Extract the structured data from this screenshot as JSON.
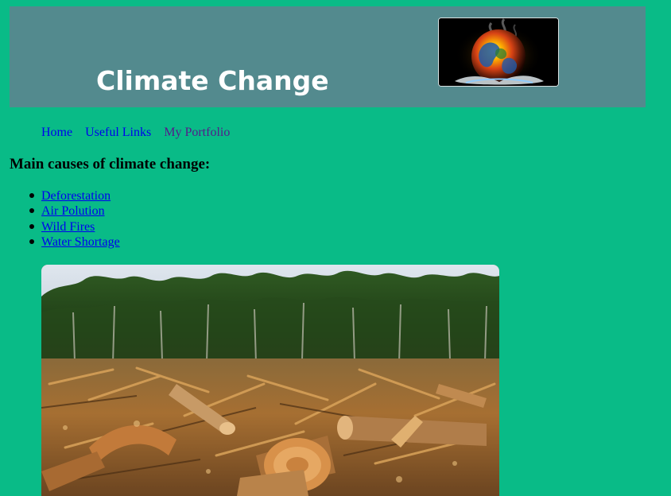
{
  "header": {
    "title": "Climate Change"
  },
  "nav": {
    "items": [
      {
        "label": "Home",
        "name": "nav-link-home",
        "visited": false
      },
      {
        "label": "Useful Links",
        "name": "nav-link-useful-links",
        "visited": false
      },
      {
        "label": "My Portfolio",
        "name": "nav-link-my-portfolio",
        "visited": true
      }
    ]
  },
  "main": {
    "heading": "Main causes of climate change:",
    "causes": [
      {
        "label": "Deforestation",
        "name": "cause-link-deforestation"
      },
      {
        "label": "Air Polution",
        "name": "cause-link-air-polution"
      },
      {
        "label": "Wild Fires",
        "name": "cause-link-wild-fires"
      },
      {
        "label": "Water Shortage",
        "name": "cause-link-water-shortage"
      }
    ]
  },
  "colors": {
    "page_background": "#09bb87",
    "header_background": "#538a8e",
    "link": "#0000ee",
    "visited_link": "#551a8b",
    "title_text": "#ffffff"
  }
}
